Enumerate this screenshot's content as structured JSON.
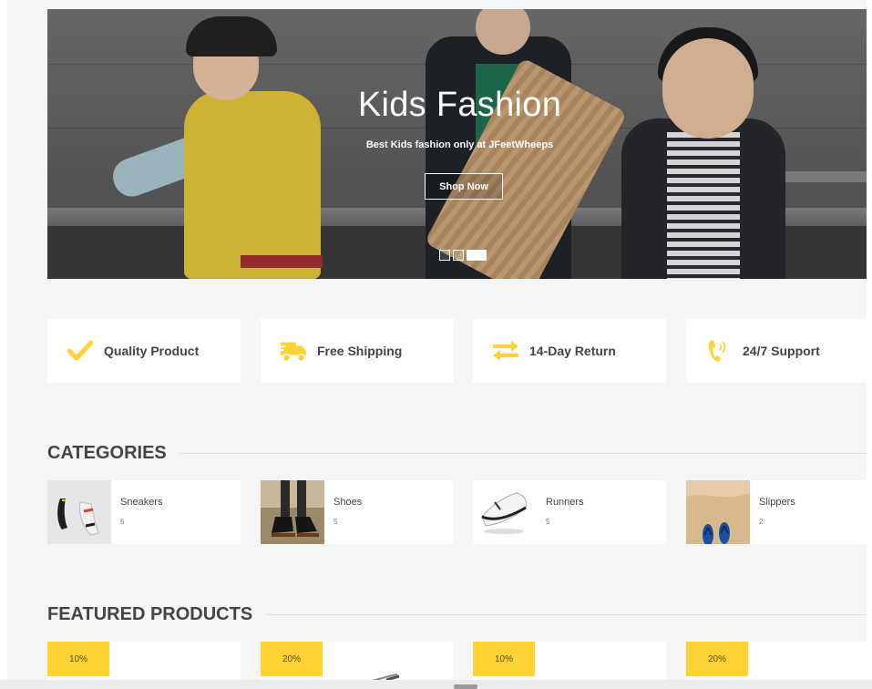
{
  "colors": {
    "accent": "#ffd333",
    "text": "#3d464d",
    "background": "#f5f5f5"
  },
  "hero": {
    "title": "Kids Fashion",
    "subtitle": "Best Kids fashion only at JFeetWheeps",
    "button": "Shop Now",
    "slides": 3,
    "active_slide": 3
  },
  "features": [
    {
      "icon": "check-icon",
      "label": "Quality Product"
    },
    {
      "icon": "truck-icon",
      "label": "Free Shipping"
    },
    {
      "icon": "exchange-icon",
      "label": "14-Day Return"
    },
    {
      "icon": "phone-volume-icon",
      "label": "24/7 Support"
    }
  ],
  "categories": {
    "title": "CATEGORIES",
    "items": [
      {
        "name": "Sneakers",
        "count": "6"
      },
      {
        "name": "Shoes",
        "count": "5"
      },
      {
        "name": "Runners",
        "count": "5"
      },
      {
        "name": "Slippers",
        "count": "2"
      }
    ]
  },
  "featured": {
    "title": "FEATURED PRODUCTS",
    "items": [
      {
        "discount": "10%"
      },
      {
        "discount": "20%"
      },
      {
        "discount": "10%"
      },
      {
        "discount": "20%"
      }
    ]
  }
}
